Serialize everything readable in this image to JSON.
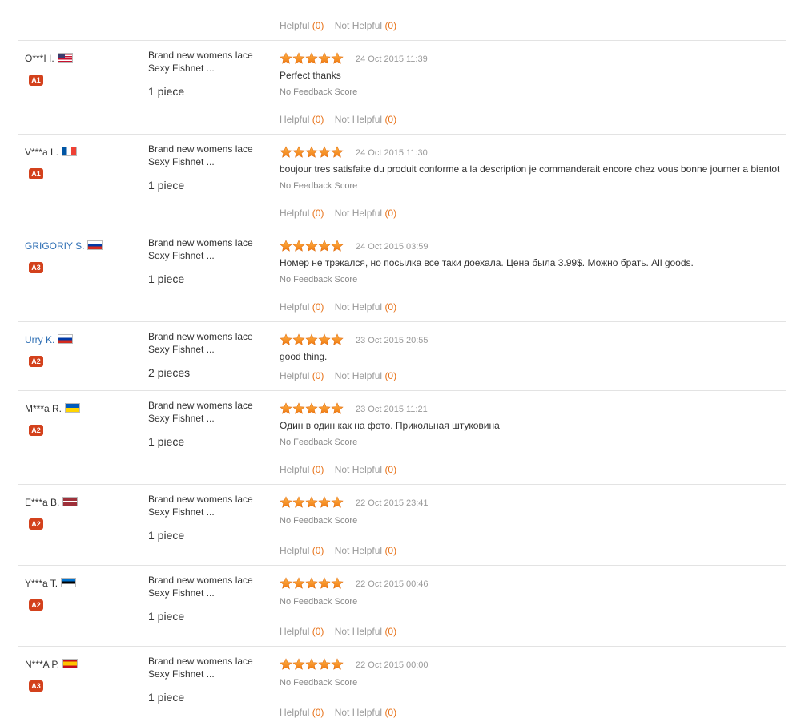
{
  "labels": {
    "helpful": "Helpful",
    "not_helpful": "Not Helpful",
    "no_feedback": "No Feedback Score"
  },
  "top": {
    "helpful_count": "(0)",
    "not_helpful_count": "(0)"
  },
  "reviews": [
    {
      "name": "O***I I.",
      "flag": "us",
      "level": "A1",
      "product": "Brand new womens lace Sexy Fishnet ...",
      "qty": "1 piece",
      "rating": 5,
      "date": "24 Oct 2015 11:39",
      "comment": "Perfect thanks",
      "helpful_count": "(0)",
      "not_helpful_count": "(0)"
    },
    {
      "name": "V***a L.",
      "flag": "fr",
      "level": "A1",
      "product": "Brand new womens lace Sexy Fishnet ...",
      "qty": "1 piece",
      "rating": 5,
      "date": "24 Oct 2015 11:30",
      "comment": "boujour tres satisfaite du produit conforme a la description je commanderait encore chez vous bonne journer a bientot",
      "helpful_count": "(0)",
      "not_helpful_count": "(0)"
    },
    {
      "name": "GRIGORIY S.",
      "flag": "ru",
      "level": "A3",
      "product": "Brand new womens lace Sexy Fishnet ...",
      "qty": "1 piece",
      "rating": 5,
      "date": "24 Oct 2015 03:59",
      "comment": "Номер не трэкался, но посылка все таки доехала. Цена была 3.99$. Можно брать. All goods.",
      "helpful_count": "(0)",
      "not_helpful_count": "(0)"
    },
    {
      "name": "Urry K.",
      "flag": "ru",
      "level": "A2",
      "product": "Brand new womens lace Sexy Fishnet ...",
      "qty": "2 pieces",
      "rating": 5,
      "date": "23 Oct 2015 20:55",
      "comment": "good thing.",
      "helpful_count": "(0)",
      "not_helpful_count": "(0)"
    },
    {
      "name": "M***a R.",
      "flag": "ua",
      "level": "A2",
      "product": "Brand new womens lace Sexy Fishnet ...",
      "qty": "1 piece",
      "rating": 5,
      "date": "23 Oct 2015 11:21",
      "comment": "Один в один как на фото. Прикольная штуковина",
      "helpful_count": "(0)",
      "not_helpful_count": "(0)"
    },
    {
      "name": "E***a B.",
      "flag": "lv",
      "level": "A2",
      "product": "Brand new womens lace Sexy Fishnet ...",
      "qty": "1 piece",
      "rating": 5,
      "date": "22 Oct 2015 23:41",
      "comment": "",
      "helpful_count": "(0)",
      "not_helpful_count": "(0)"
    },
    {
      "name": "Y***a T.",
      "flag": "ee",
      "level": "A2",
      "product": "Brand new womens lace Sexy Fishnet ...",
      "qty": "1 piece",
      "rating": 5,
      "date": "22 Oct 2015 00:46",
      "comment": "",
      "helpful_count": "(0)",
      "not_helpful_count": "(0)"
    },
    {
      "name": "N***A P.",
      "flag": "es",
      "level": "A3",
      "product": "Brand new womens lace Sexy Fishnet ...",
      "qty": "1 piece",
      "rating": 5,
      "date": "22 Oct 2015 00:00",
      "comment": "",
      "helpful_count": "(0)",
      "not_helpful_count": "(0)"
    }
  ]
}
